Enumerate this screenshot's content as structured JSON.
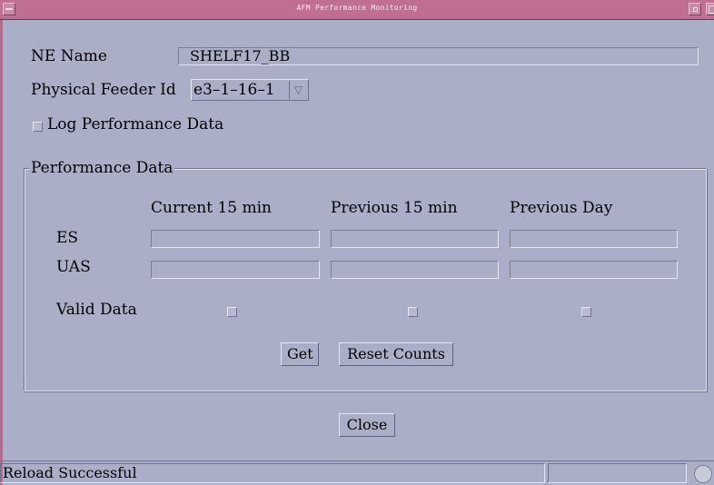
{
  "window": {
    "title": "AFM Performance Monitoring"
  },
  "ne_name": {
    "label": "NE Name",
    "value": "SHELF17_BB"
  },
  "feeder": {
    "label": "Physical Feeder Id",
    "value": "e3–1–16–1",
    "arrow_glyph": "▽"
  },
  "log_checkbox": {
    "label": "Log Performance Data",
    "checked": false
  },
  "performance": {
    "title": "Performance Data",
    "columns": [
      "Current 15 min",
      "Previous 15 min",
      "Previous Day"
    ],
    "rows": [
      {
        "label": "ES",
        "values": [
          "",
          "",
          ""
        ]
      },
      {
        "label": "UAS",
        "values": [
          "",
          "",
          ""
        ]
      }
    ],
    "valid_label": "Valid Data",
    "valid_checked": [
      false,
      false,
      false
    ],
    "get_label": "Get",
    "reset_label": "Reset Counts"
  },
  "close_label": "Close",
  "status": {
    "message": "Reload Successful",
    "secondary": ""
  },
  "icons": {
    "window_menu": "window-menu-icon",
    "minimize": "minimize-icon",
    "maximize": "maximize-icon",
    "status": "status-indicator-icon"
  },
  "colors": {
    "background": "#aaaec6",
    "titlebar": "#c06e94"
  }
}
